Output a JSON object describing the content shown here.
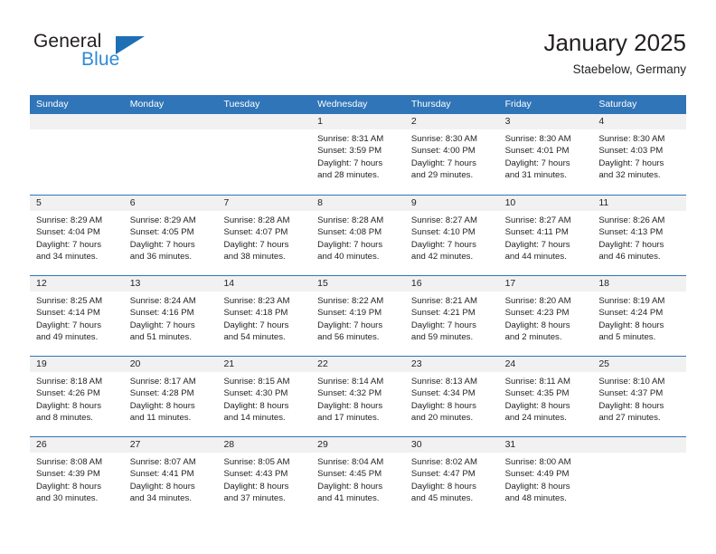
{
  "brand": {
    "word_top": "General",
    "word_bottom": "Blue",
    "triangle_color": "#1f6fb5",
    "blue_color": "#2e8bd8"
  },
  "header": {
    "title": "January 2025",
    "subtitle": "Staebelow, Germany"
  },
  "theme": {
    "header_blue": "#3075b8",
    "day_band_gray": "#f1f1f1",
    "text_color": "#231f20"
  },
  "weekday_headers": [
    "Sunday",
    "Monday",
    "Tuesday",
    "Wednesday",
    "Thursday",
    "Friday",
    "Saturday"
  ],
  "weeks": [
    [
      {
        "day": "",
        "lines": []
      },
      {
        "day": "",
        "lines": []
      },
      {
        "day": "",
        "lines": []
      },
      {
        "day": "1",
        "lines": [
          "Sunrise: 8:31 AM",
          "Sunset: 3:59 PM",
          "Daylight: 7 hours",
          "and 28 minutes."
        ]
      },
      {
        "day": "2",
        "lines": [
          "Sunrise: 8:30 AM",
          "Sunset: 4:00 PM",
          "Daylight: 7 hours",
          "and 29 minutes."
        ]
      },
      {
        "day": "3",
        "lines": [
          "Sunrise: 8:30 AM",
          "Sunset: 4:01 PM",
          "Daylight: 7 hours",
          "and 31 minutes."
        ]
      },
      {
        "day": "4",
        "lines": [
          "Sunrise: 8:30 AM",
          "Sunset: 4:03 PM",
          "Daylight: 7 hours",
          "and 32 minutes."
        ]
      }
    ],
    [
      {
        "day": "5",
        "lines": [
          "Sunrise: 8:29 AM",
          "Sunset: 4:04 PM",
          "Daylight: 7 hours",
          "and 34 minutes."
        ]
      },
      {
        "day": "6",
        "lines": [
          "Sunrise: 8:29 AM",
          "Sunset: 4:05 PM",
          "Daylight: 7 hours",
          "and 36 minutes."
        ]
      },
      {
        "day": "7",
        "lines": [
          "Sunrise: 8:28 AM",
          "Sunset: 4:07 PM",
          "Daylight: 7 hours",
          "and 38 minutes."
        ]
      },
      {
        "day": "8",
        "lines": [
          "Sunrise: 8:28 AM",
          "Sunset: 4:08 PM",
          "Daylight: 7 hours",
          "and 40 minutes."
        ]
      },
      {
        "day": "9",
        "lines": [
          "Sunrise: 8:27 AM",
          "Sunset: 4:10 PM",
          "Daylight: 7 hours",
          "and 42 minutes."
        ]
      },
      {
        "day": "10",
        "lines": [
          "Sunrise: 8:27 AM",
          "Sunset: 4:11 PM",
          "Daylight: 7 hours",
          "and 44 minutes."
        ]
      },
      {
        "day": "11",
        "lines": [
          "Sunrise: 8:26 AM",
          "Sunset: 4:13 PM",
          "Daylight: 7 hours",
          "and 46 minutes."
        ]
      }
    ],
    [
      {
        "day": "12",
        "lines": [
          "Sunrise: 8:25 AM",
          "Sunset: 4:14 PM",
          "Daylight: 7 hours",
          "and 49 minutes."
        ]
      },
      {
        "day": "13",
        "lines": [
          "Sunrise: 8:24 AM",
          "Sunset: 4:16 PM",
          "Daylight: 7 hours",
          "and 51 minutes."
        ]
      },
      {
        "day": "14",
        "lines": [
          "Sunrise: 8:23 AM",
          "Sunset: 4:18 PM",
          "Daylight: 7 hours",
          "and 54 minutes."
        ]
      },
      {
        "day": "15",
        "lines": [
          "Sunrise: 8:22 AM",
          "Sunset: 4:19 PM",
          "Daylight: 7 hours",
          "and 56 minutes."
        ]
      },
      {
        "day": "16",
        "lines": [
          "Sunrise: 8:21 AM",
          "Sunset: 4:21 PM",
          "Daylight: 7 hours",
          "and 59 minutes."
        ]
      },
      {
        "day": "17",
        "lines": [
          "Sunrise: 8:20 AM",
          "Sunset: 4:23 PM",
          "Daylight: 8 hours",
          "and 2 minutes."
        ]
      },
      {
        "day": "18",
        "lines": [
          "Sunrise: 8:19 AM",
          "Sunset: 4:24 PM",
          "Daylight: 8 hours",
          "and 5 minutes."
        ]
      }
    ],
    [
      {
        "day": "19",
        "lines": [
          "Sunrise: 8:18 AM",
          "Sunset: 4:26 PM",
          "Daylight: 8 hours",
          "and 8 minutes."
        ]
      },
      {
        "day": "20",
        "lines": [
          "Sunrise: 8:17 AM",
          "Sunset: 4:28 PM",
          "Daylight: 8 hours",
          "and 11 minutes."
        ]
      },
      {
        "day": "21",
        "lines": [
          "Sunrise: 8:15 AM",
          "Sunset: 4:30 PM",
          "Daylight: 8 hours",
          "and 14 minutes."
        ]
      },
      {
        "day": "22",
        "lines": [
          "Sunrise: 8:14 AM",
          "Sunset: 4:32 PM",
          "Daylight: 8 hours",
          "and 17 minutes."
        ]
      },
      {
        "day": "23",
        "lines": [
          "Sunrise: 8:13 AM",
          "Sunset: 4:34 PM",
          "Daylight: 8 hours",
          "and 20 minutes."
        ]
      },
      {
        "day": "24",
        "lines": [
          "Sunrise: 8:11 AM",
          "Sunset: 4:35 PM",
          "Daylight: 8 hours",
          "and 24 minutes."
        ]
      },
      {
        "day": "25",
        "lines": [
          "Sunrise: 8:10 AM",
          "Sunset: 4:37 PM",
          "Daylight: 8 hours",
          "and 27 minutes."
        ]
      }
    ],
    [
      {
        "day": "26",
        "lines": [
          "Sunrise: 8:08 AM",
          "Sunset: 4:39 PM",
          "Daylight: 8 hours",
          "and 30 minutes."
        ]
      },
      {
        "day": "27",
        "lines": [
          "Sunrise: 8:07 AM",
          "Sunset: 4:41 PM",
          "Daylight: 8 hours",
          "and 34 minutes."
        ]
      },
      {
        "day": "28",
        "lines": [
          "Sunrise: 8:05 AM",
          "Sunset: 4:43 PM",
          "Daylight: 8 hours",
          "and 37 minutes."
        ]
      },
      {
        "day": "29",
        "lines": [
          "Sunrise: 8:04 AM",
          "Sunset: 4:45 PM",
          "Daylight: 8 hours",
          "and 41 minutes."
        ]
      },
      {
        "day": "30",
        "lines": [
          "Sunrise: 8:02 AM",
          "Sunset: 4:47 PM",
          "Daylight: 8 hours",
          "and 45 minutes."
        ]
      },
      {
        "day": "31",
        "lines": [
          "Sunrise: 8:00 AM",
          "Sunset: 4:49 PM",
          "Daylight: 8 hours",
          "and 48 minutes."
        ]
      },
      {
        "day": "",
        "lines": []
      }
    ]
  ]
}
